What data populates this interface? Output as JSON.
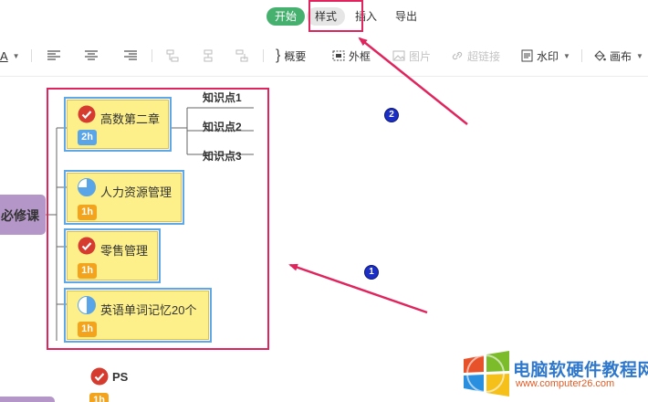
{
  "tabs": {
    "start": "开始",
    "style": "样式",
    "insert": "插入",
    "export": "导出"
  },
  "toolbar": {
    "font_color_glyph": "A",
    "summary": "概要",
    "border": "外框",
    "image": "图片",
    "hyperlink": "超链接",
    "watermark": "水印",
    "canvas": "画布"
  },
  "mindmap": {
    "root_label": "必修课",
    "nodes": [
      {
        "title": "高数第二章",
        "badge": "2h",
        "status": "done"
      },
      {
        "title": "人力资源管理",
        "badge": "1h",
        "status": "quarter"
      },
      {
        "title": "零售管理",
        "badge": "1h",
        "status": "done"
      },
      {
        "title": "英语单词记忆20个",
        "badge": "1h",
        "status": "half"
      }
    ],
    "subtopics": [
      "知识点1",
      "知识点2",
      "知识点3"
    ],
    "next_node_title": "PS",
    "next_node_badge": "1h"
  },
  "annotations": {
    "callout_1": "1",
    "callout_2": "2",
    "arrow_color": "#e0245e"
  },
  "watermark": {
    "title": "电脑软硬件教程网",
    "url": "www.computer26.com"
  },
  "colors": {
    "tab_active": "#46b16f",
    "node_fill": "#fdf08a",
    "selection": "#5ea7e8",
    "root_fill": "#b596c9",
    "badge_blue": "#5aa4e8",
    "badge_orange": "#f3a31c"
  }
}
